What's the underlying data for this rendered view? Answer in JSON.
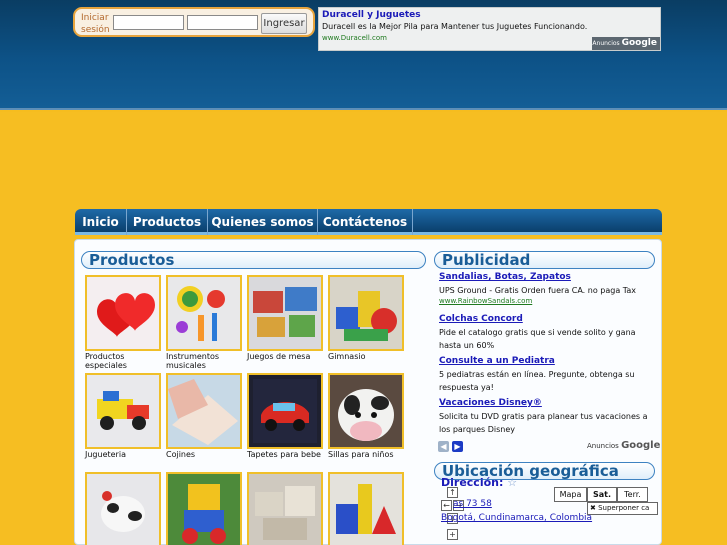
{
  "login": {
    "label": "Iniciar sesión",
    "user_value": "",
    "pass_value": "",
    "button": "Ingresar"
  },
  "top_ad": {
    "title": "Duracell y Juguetes",
    "description": "Duracell es la Mejor Pila para Mantener tus Juguetes Funcionando.",
    "url": "www.Duracell.com",
    "badge_prefix": "Anuncios",
    "badge_brand": "Google"
  },
  "nav": {
    "items": [
      "Inicio",
      "Productos",
      "Quienes somos",
      "Contáctenos"
    ]
  },
  "products": {
    "heading": "Productos",
    "items": [
      {
        "caption": "Productos especiales",
        "thumb": "red-hearts"
      },
      {
        "caption": "Instrumentos musicales",
        "thumb": "toy-instruments"
      },
      {
        "caption": "Juegos de mesa",
        "thumb": "board-games"
      },
      {
        "caption": "Gimnasio",
        "thumb": "foam-blocks"
      },
      {
        "caption": "Jugueteria",
        "thumb": "toy-truck"
      },
      {
        "caption": "Cojines",
        "thumb": "pillows"
      },
      {
        "caption": "Tapetes para bebe",
        "thumb": "cars-mat"
      },
      {
        "caption": "Sillas para niños",
        "thumb": "cow-chair"
      },
      {
        "caption": "",
        "thumb": "plush-cow"
      },
      {
        "caption": "",
        "thumb": "robot-toy"
      },
      {
        "caption": "",
        "thumb": "cardboard-boxes"
      },
      {
        "caption": "",
        "thumb": "color-blocks"
      }
    ]
  },
  "publicidad": {
    "heading": "Publicidad",
    "ads": [
      {
        "title": "Sandalias, Botas, Zapatos",
        "description": "UPS Ground - Gratis Orden fuera CA. no paga Tax",
        "url": "www.RainbowSandals.com"
      },
      {
        "title": "Colchas Concord",
        "description": "Pide el catalogo gratis que si vende solito y gana hasta un 60%",
        "url": ""
      },
      {
        "title": "Consulte a un Pediatra",
        "description": "5 pediatras están en línea. Pregunte, obtenga su respuesta ya!",
        "url": ""
      },
      {
        "title": "Vacaciones Disney®",
        "description": "Solicita tu DVD gratis para planear tus vacaciones a los parques Disney",
        "url": ""
      }
    ],
    "badge_prefix": "Anuncios",
    "badge_brand": "Google"
  },
  "geo": {
    "heading": "Ubicación geográfica",
    "label": "Dirección:",
    "addr_line1": "as 73 58",
    "addr_line2": "Bogotá, Cundinamarca, Colombia",
    "map_buttons": [
      "Mapa",
      "Sat.",
      "Terr."
    ],
    "overlay_label": "Superponer ca"
  },
  "colors": {
    "header_blue": "#0d5287",
    "page_yellow": "#f6be22",
    "link_blue": "#1b1bb8",
    "heading_blue": "#1a5d97"
  }
}
